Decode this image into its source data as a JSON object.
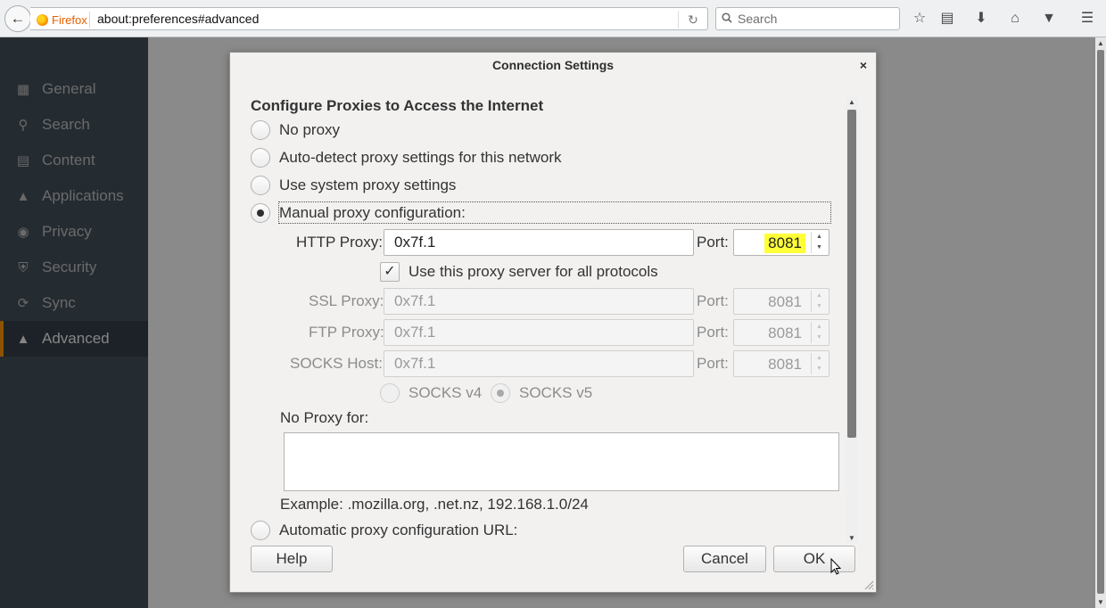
{
  "browser": {
    "identity_label": "Firefox",
    "url": "about:preferences#advanced",
    "search_placeholder": "Search"
  },
  "sidebar": {
    "items": [
      {
        "label": "General",
        "icon": "general-icon"
      },
      {
        "label": "Search",
        "icon": "search-icon"
      },
      {
        "label": "Content",
        "icon": "content-icon"
      },
      {
        "label": "Applications",
        "icon": "applications-icon"
      },
      {
        "label": "Privacy",
        "icon": "privacy-mask-icon"
      },
      {
        "label": "Security",
        "icon": "security-shield-icon"
      },
      {
        "label": "Sync",
        "icon": "sync-icon"
      },
      {
        "label": "Advanced",
        "icon": "advanced-wizard-icon",
        "selected": true
      }
    ]
  },
  "dialog": {
    "title": "Connection Settings",
    "section_title": "Configure Proxies to Access the Internet",
    "options": {
      "no_proxy": "No proxy",
      "auto_detect": "Auto-detect proxy settings for this network",
      "system": "Use system proxy settings",
      "manual": "Manual proxy configuration:",
      "auto_url": "Automatic proxy configuration URL:"
    },
    "selected_option": "manual",
    "http": {
      "label": "HTTP Proxy:",
      "value": "0x7f.1",
      "port_label": "Port:",
      "port": "8081"
    },
    "use_for_all": {
      "label": "Use this proxy server for all protocols",
      "checked": true
    },
    "ssl": {
      "label": "SSL Proxy:",
      "value": "0x7f.1",
      "port_label": "Port:",
      "port": "8081"
    },
    "ftp": {
      "label": "FTP Proxy:",
      "value": "0x7f.1",
      "port_label": "Port:",
      "port": "8081"
    },
    "socks": {
      "label": "SOCKS Host:",
      "value": "0x7f.1",
      "port_label": "Port:",
      "port": "8081"
    },
    "socks_v4": "SOCKS v4",
    "socks_v5": "SOCKS v5",
    "no_proxy_for_label": "No Proxy for:",
    "no_proxy_for_value": "",
    "example": "Example: .mozilla.org, .net.nz, 192.168.1.0/24",
    "buttons": {
      "help": "Help",
      "cancel": "Cancel",
      "ok": "OK"
    }
  },
  "colors": {
    "sidebar_bg": "#424f5a",
    "accent": "#ff9500",
    "highlight": "#ffff38"
  }
}
